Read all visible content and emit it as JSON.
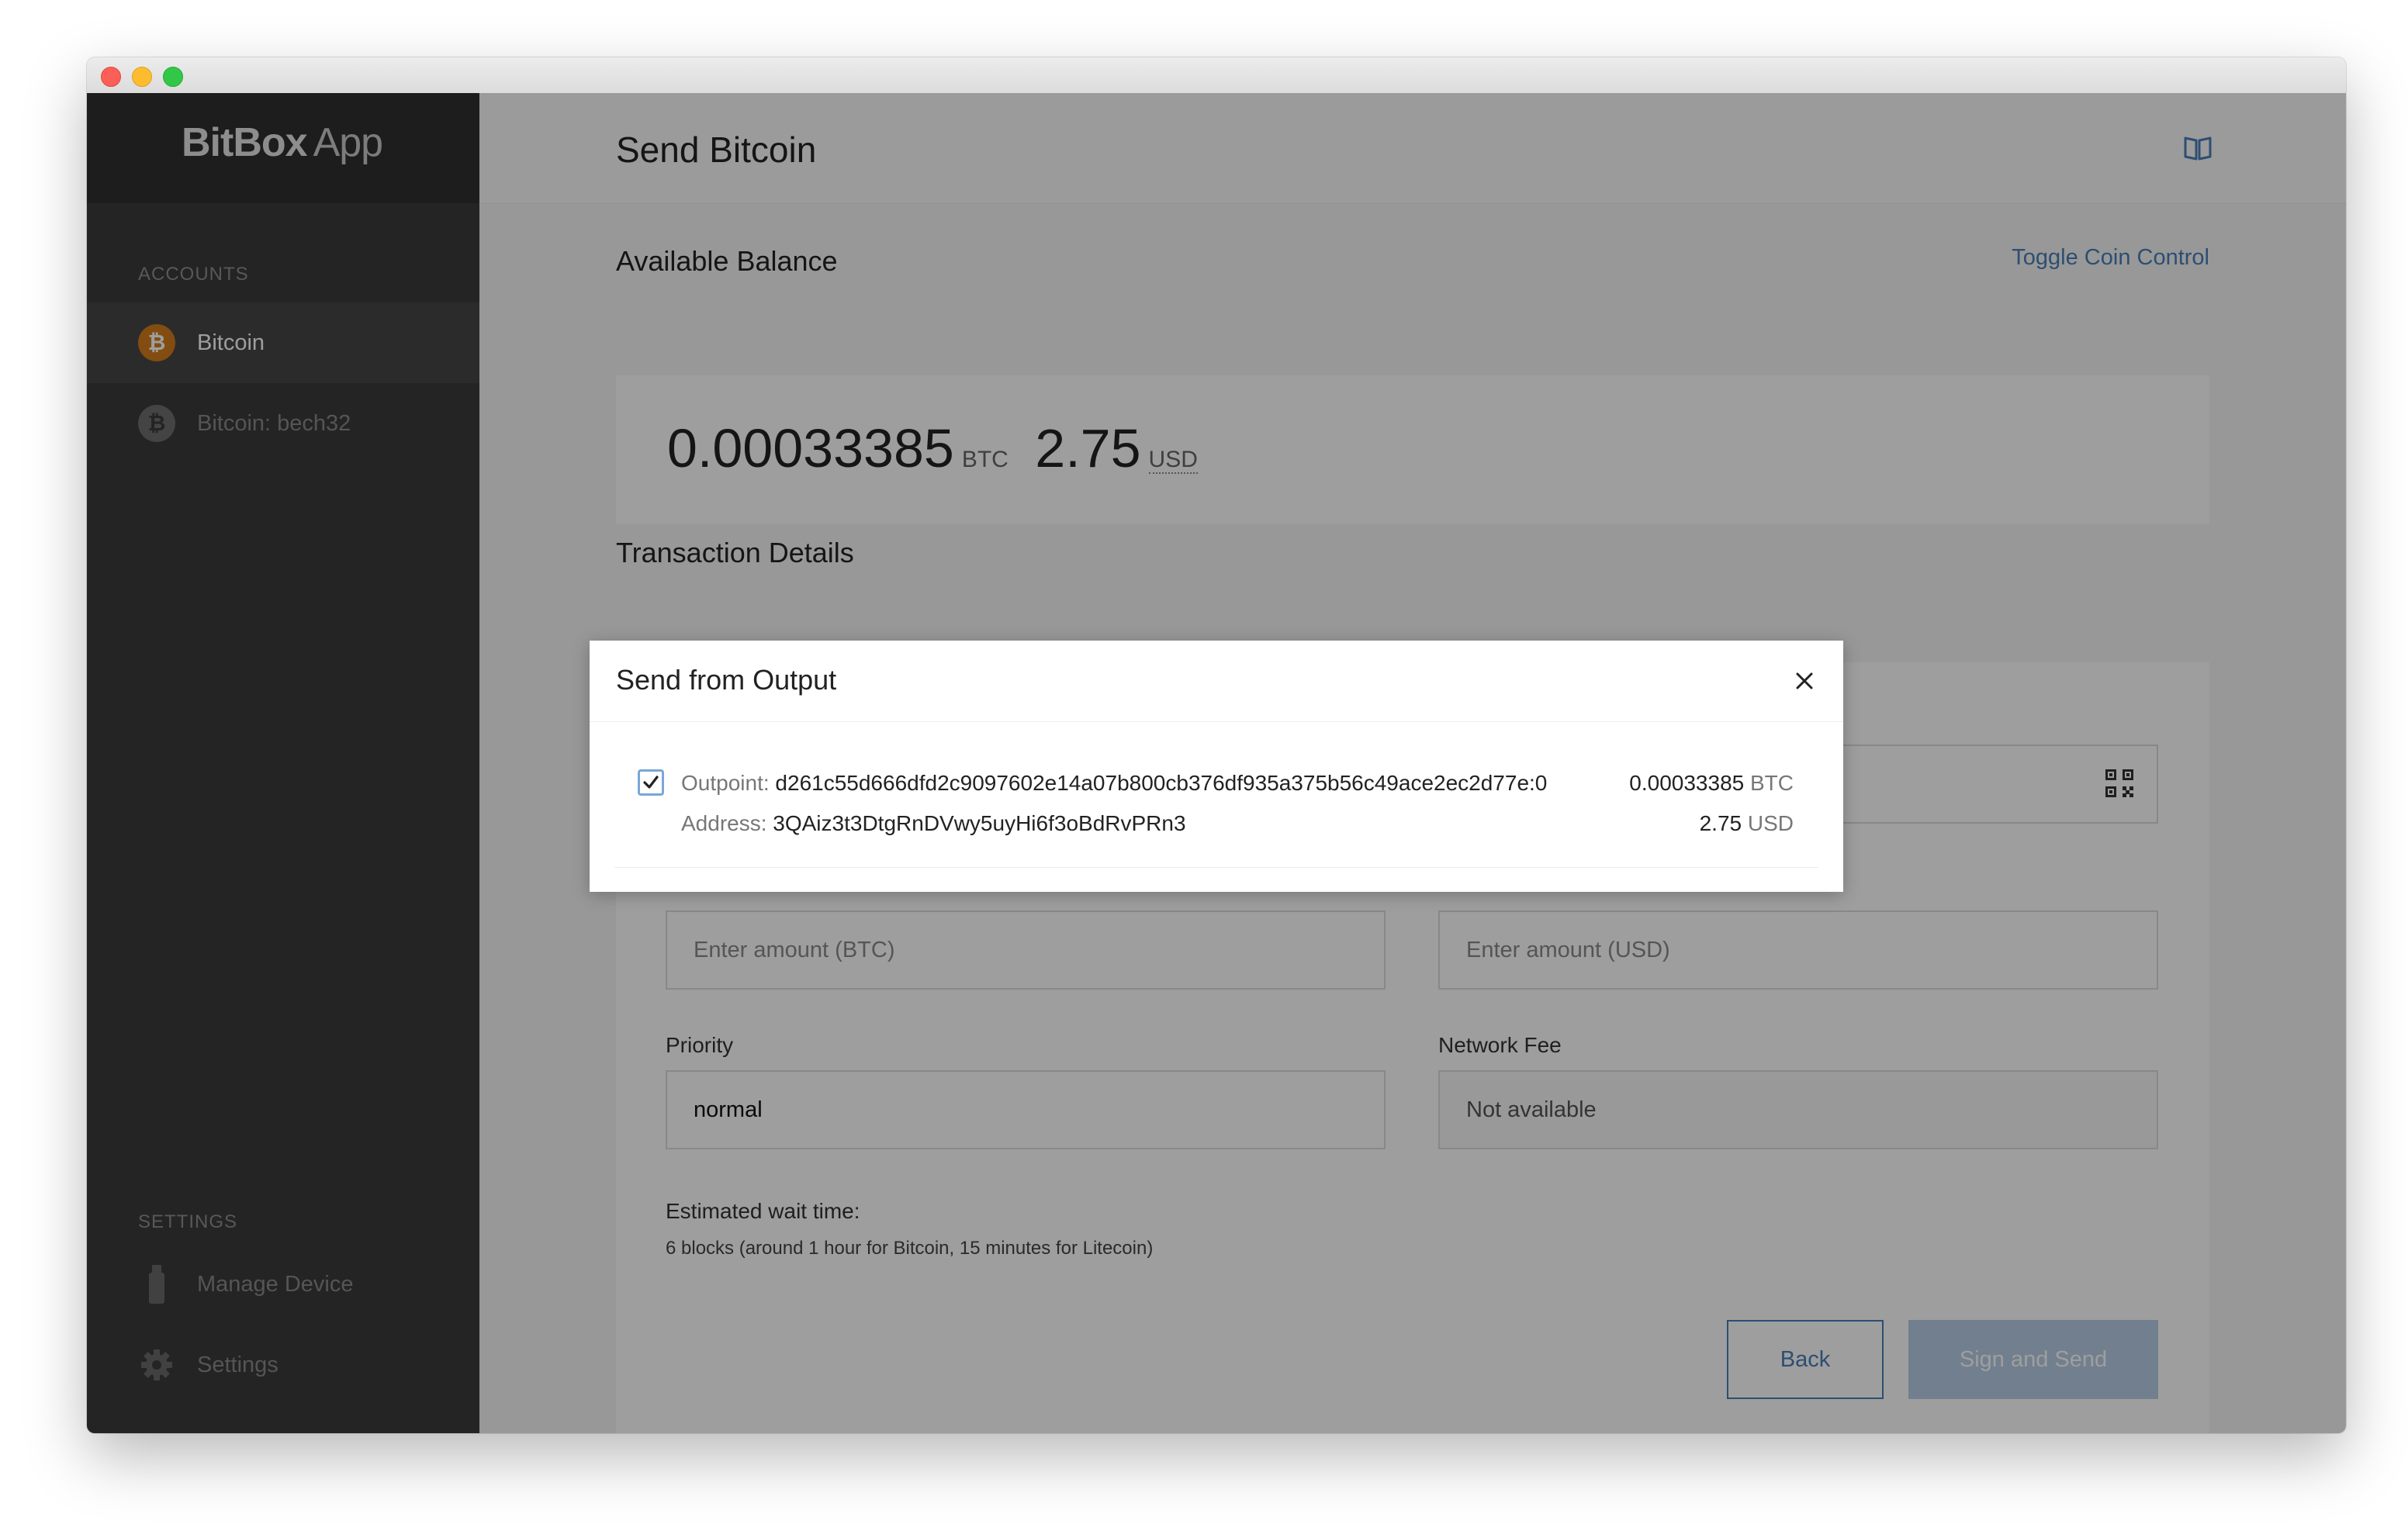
{
  "app": {
    "logo_bold": "BitBox",
    "logo_light": "App"
  },
  "sidebar": {
    "accounts_title": "ACCOUNTS",
    "accounts": [
      {
        "label": "Bitcoin",
        "icon": "bitcoin-icon",
        "active": true
      },
      {
        "label": "Bitcoin: bech32",
        "icon": "bitcoin-icon",
        "active": false
      }
    ],
    "settings_title": "SETTINGS",
    "settings": [
      {
        "label": "Manage Device",
        "icon": "usb-device-icon"
      },
      {
        "label": "Settings",
        "icon": "gear-icon"
      }
    ]
  },
  "header": {
    "title": "Send Bitcoin",
    "guide_icon": "book-icon"
  },
  "balance": {
    "title": "Available Balance",
    "toggle_link": "Toggle Coin Control",
    "btc_amount": "0.00033385",
    "btc_unit": "BTC",
    "usd_amount": "2.75",
    "usd_unit": "USD"
  },
  "transaction": {
    "title": "Transaction Details",
    "amount_btc_placeholder": "Enter amount (BTC)",
    "amount_usd_placeholder": "Enter amount (USD)",
    "priority_label": "Priority",
    "priority_value": "normal",
    "fee_label": "Network Fee",
    "fee_value": "Not available",
    "wait_label": "Estimated wait time:",
    "wait_value": "6 blocks (around 1 hour for Bitcoin, 15 minutes for Litecoin)",
    "back_button": "Back",
    "send_button": "Sign and Send"
  },
  "modal": {
    "title": "Send from Output",
    "checked": true,
    "outpoint_label": "Outpoint:",
    "outpoint_value": "d261c55d666dfd2c9097602e14a07b800cb376df935a375b56c49ace2ec2d77e:0",
    "amount_btc": "0.00033385",
    "btc_unit": "BTC",
    "address_label": "Address:",
    "address_value": "3QAiz3t3DtgRnDVwy5uyHi6f3oBdRvPRn3",
    "amount_usd": "2.75",
    "usd_unit": "USD"
  },
  "colors": {
    "accent": "#4a7fb8",
    "sidebar": "#3a3a3a",
    "bitcoin": "#d47b1c"
  }
}
